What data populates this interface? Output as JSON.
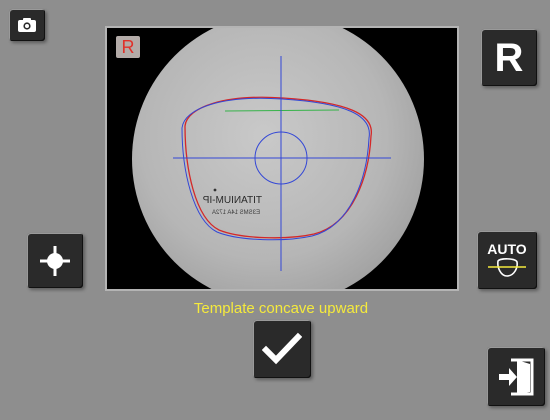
{
  "viewport": {
    "side_badge": "R",
    "lens_engraving_line1": "TITANIUM-IP",
    "lens_engraving_line2": "E3SMS 14A 172A"
  },
  "status_message": "Template concave upward",
  "buttons": {
    "camera_icon": "camera-icon",
    "crosshair_icon": "crosshair-icon",
    "side_label": "R",
    "auto_label": "AUTO",
    "auto_icon": "lens-outline-icon",
    "confirm_icon": "checkmark-icon",
    "exit_icon": "exit-door-icon"
  },
  "colors": {
    "background": "#8e8e8e",
    "button": "#2a2a2a",
    "status_text": "#f5ea3c",
    "side_badge_text": "#e0312a",
    "crosshair": "#3347d6",
    "trace_red": "#d42828",
    "trace_green": "#37b34a"
  }
}
